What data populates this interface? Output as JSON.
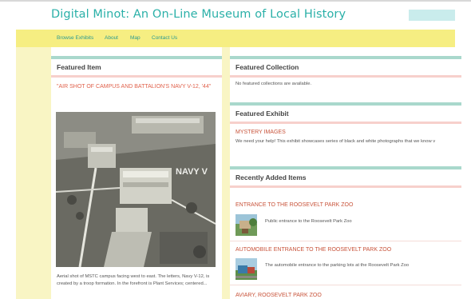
{
  "site": {
    "title": "Digital Minot: An On-Line Museum of Local History"
  },
  "search": {
    "placeholder": ""
  },
  "nav": {
    "items": [
      {
        "label": "Browse Exhibits"
      },
      {
        "label": "About"
      },
      {
        "label": "Map"
      },
      {
        "label": "Contact Us"
      }
    ]
  },
  "featured_item": {
    "heading": "Featured Item",
    "title": "\"AIR SHOT OF CAMPUS AND BATTALION'S NAVY V-12, '44\"",
    "image_text": "NAVY V",
    "description": "Aerial shot of MSTC campus facing west to east. The letters, Navy V-12, is created by a troop formation. In the forefront is Plant Services; centered..."
  },
  "featured_collection": {
    "heading": "Featured Collection",
    "text": "No featured collections are available."
  },
  "featured_exhibit": {
    "heading": "Featured Exhibit",
    "title": "MYSTERY IMAGES",
    "text": "We need your help! This exhibit showcases series of black and white photographs that we know v"
  },
  "recent": {
    "heading": "Recently Added Items",
    "items": [
      {
        "title": "ENTRANCE TO THE ROOSEVELT PARK ZOO",
        "description": "Public entrance to the Roosevelt Park Zoo"
      },
      {
        "title": "AUTOMOBILE ENTRANCE TO THE ROOSEVELT PARK ZOO",
        "description": "The automobile entrance to the parking lots at the Roosevelt Park Zoo"
      },
      {
        "title": "AVIARY, ROOSEVELT PARK ZOO",
        "description": ""
      }
    ]
  },
  "colors": {
    "accent": "#2ab0a8",
    "nav_bg": "#f6ee82",
    "side_band": "#f9f5c4",
    "link": "#c8533a",
    "panel_top": "#a9d8cc",
    "panel_rule": "#f7d0cc"
  }
}
